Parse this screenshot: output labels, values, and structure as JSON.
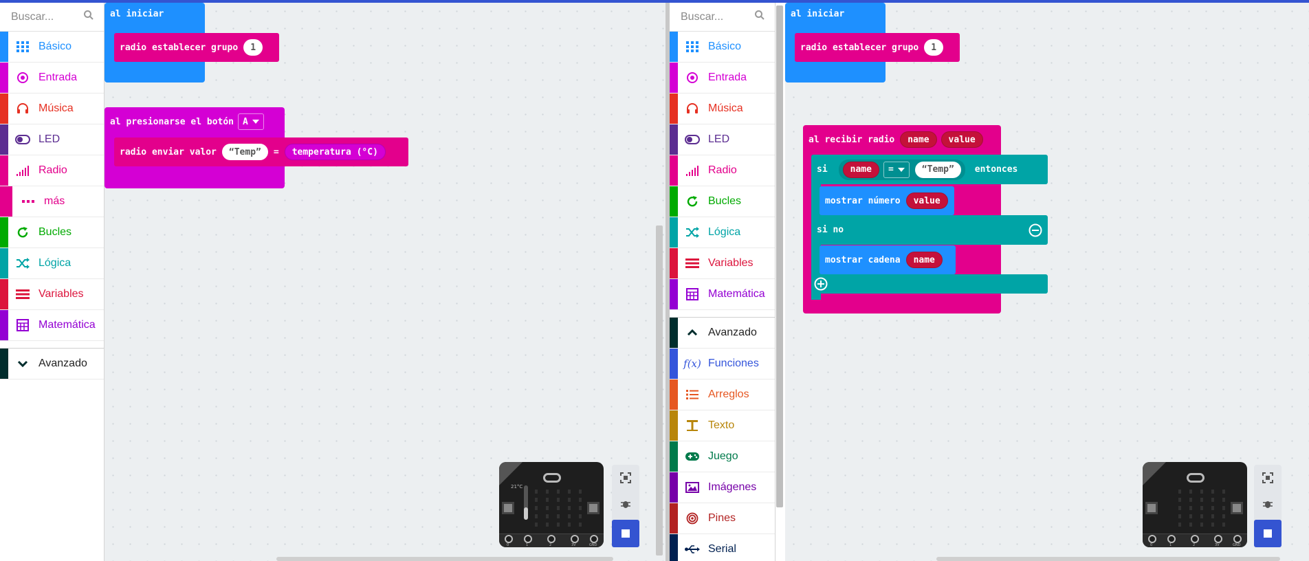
{
  "colors": {
    "accent": "#3454d1",
    "basico": "#1e90ff",
    "entrada": "#d400d4",
    "musica": "#e63022",
    "led": "#5c2d91",
    "radio": "#e3008c",
    "bucles": "#00aa00",
    "logica": "#00a4a6",
    "variables": "#dc143c",
    "matematica": "#9400d3",
    "avanzado": "#002d2d",
    "funciones": "#3455db",
    "arreglos": "#e65722",
    "texto": "#b8860b",
    "juego": "#007a4b",
    "imagenes": "#7600a8",
    "pines": "#b22222",
    "serial": "#002050"
  },
  "left": {
    "search_placeholder": "Buscar...",
    "categories": [
      {
        "label": "Básico",
        "icon": "grid-icon"
      },
      {
        "label": "Entrada",
        "icon": "target-icon"
      },
      {
        "label": "Música",
        "icon": "headphones-icon"
      },
      {
        "label": "LED",
        "icon": "toggle-icon"
      },
      {
        "label": "Radio",
        "icon": "signal-bars-icon"
      },
      {
        "label": "más",
        "icon": "more-dots-icon"
      },
      {
        "label": "Bucles",
        "icon": "refresh-icon"
      },
      {
        "label": "Lógica",
        "icon": "shuffle-icon"
      },
      {
        "label": "Variables",
        "icon": "lines-icon"
      },
      {
        "label": "Matemática",
        "icon": "calculator-icon"
      }
    ],
    "advanced": {
      "label": "Avanzado",
      "icon": "chevron-down-icon"
    },
    "blocks": {
      "on_start": "al iniciar",
      "set_group": "radio establecer grupo",
      "group_value": "1",
      "on_button": "al presionarse el botón",
      "button_value": "A",
      "send_value": "radio enviar valor",
      "temp_string": "Temp",
      "eq": "=",
      "temperature": "temperatura (°C)"
    },
    "sim": {
      "temp": "21°C"
    }
  },
  "right": {
    "search_placeholder": "Buscar...",
    "categories": [
      {
        "label": "Básico",
        "icon": "grid-icon"
      },
      {
        "label": "Entrada",
        "icon": "target-icon"
      },
      {
        "label": "Música",
        "icon": "headphones-icon"
      },
      {
        "label": "LED",
        "icon": "toggle-icon"
      },
      {
        "label": "Radio",
        "icon": "signal-bars-icon"
      },
      {
        "label": "Bucles",
        "icon": "refresh-icon"
      },
      {
        "label": "Lógica",
        "icon": "shuffle-icon"
      },
      {
        "label": "Variables",
        "icon": "lines-icon"
      },
      {
        "label": "Matemática",
        "icon": "calculator-icon"
      }
    ],
    "advanced": {
      "label": "Avanzado",
      "icon": "chevron-up-icon"
    },
    "advanced_categories": [
      {
        "label": "Funciones",
        "icon": "function-icon"
      },
      {
        "label": "Arreglos",
        "icon": "list-icon"
      },
      {
        "label": "Texto",
        "icon": "text-icon"
      },
      {
        "label": "Juego",
        "icon": "gamepad-icon"
      },
      {
        "label": "Imágenes",
        "icon": "image-icon"
      },
      {
        "label": "Pines",
        "icon": "pin-target-icon"
      },
      {
        "label": "Serial",
        "icon": "usb-icon"
      }
    ],
    "blocks": {
      "on_start": "al iniciar",
      "set_group": "radio establecer grupo",
      "group_value": "1",
      "on_receive": "al recibir radio",
      "param_name": "name",
      "param_value": "value",
      "if": "si",
      "eq": "=",
      "temp_string": "Temp",
      "then": "entonces",
      "show_number": "mostrar número",
      "else": "si no",
      "show_string": "mostrar cadena"
    }
  },
  "sim_pins": [
    "0",
    "1",
    "2",
    "3V",
    "GND"
  ]
}
